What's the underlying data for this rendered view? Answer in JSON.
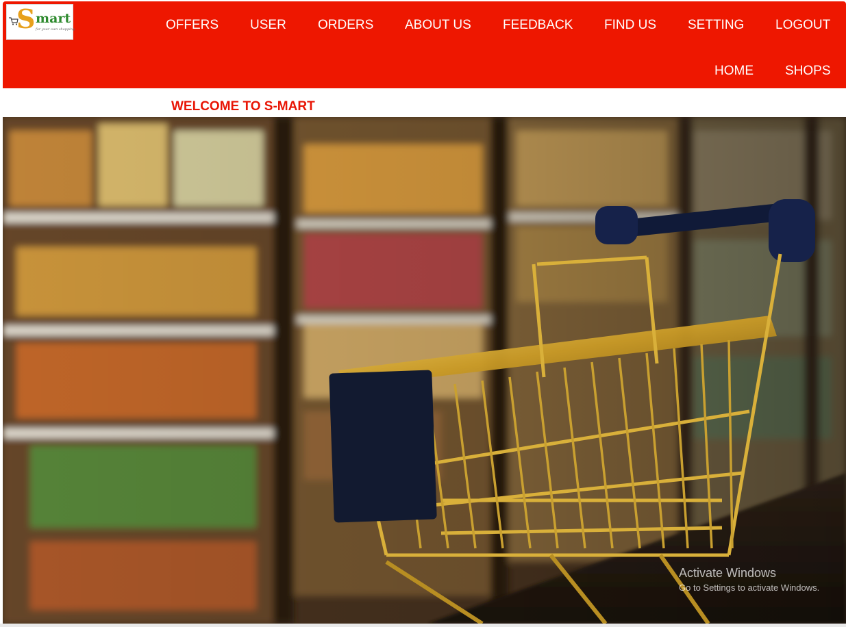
{
  "logo": {
    "text": "mart",
    "s_glyph": "S",
    "tagline": "for your own shopping",
    "icon": "shopping-cart-icon"
  },
  "nav": {
    "row1": [
      "OFFERS",
      "USER",
      "ORDERS",
      "ABOUT US",
      "FEEDBACK",
      "FIND US",
      "SETTING",
      "LOGOUT"
    ],
    "row2": [
      "HOME",
      "SHOPS"
    ]
  },
  "welcome": "WELCOME TO S-MART",
  "hero": {
    "subject": "shopping-cart-in-supermarket-aisle"
  },
  "watermark": {
    "title": "Activate Windows",
    "subtitle": "Go to Settings to activate Windows."
  },
  "colors": {
    "navbar": "#ee1700",
    "welcome_text": "#e81505",
    "logo_green": "#2e8a2e",
    "logo_gold": "#e7a01c"
  }
}
